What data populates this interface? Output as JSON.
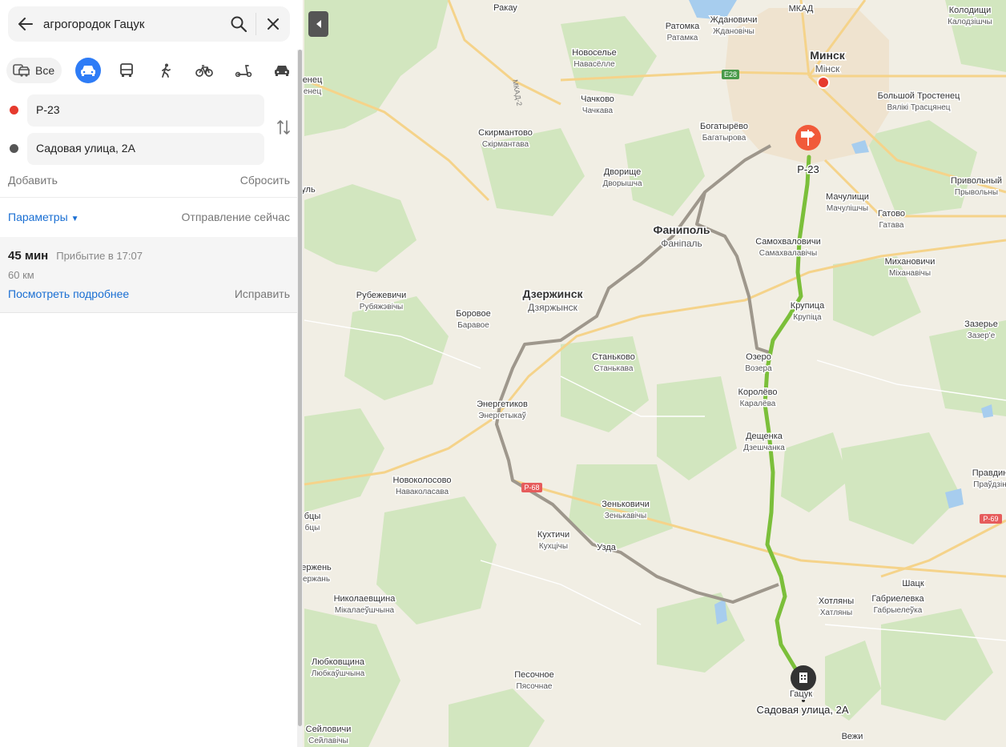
{
  "search": {
    "query": "агрогородок Гацук"
  },
  "modes": {
    "all_label": "Все"
  },
  "route": {
    "from": "Р-23",
    "to": "Садовая улица, 2А",
    "add_label": "Добавить",
    "reset_label": "Сбросить",
    "params_label": "Параметры",
    "depart_label": "Отправление сейчас"
  },
  "result": {
    "duration": "45 мин",
    "arrival": "Прибытие в 17:07",
    "distance": "60 км",
    "details_label": "Посмотреть подробнее",
    "fix_label": "Исправить"
  },
  "colors": {
    "accent": "#2e7cf6",
    "route_green": "#7bbf3a",
    "route_alt": "#a09a90",
    "start_dot": "#e63a2e",
    "end_dot": "#555555",
    "link": "#1a6fd3"
  },
  "map": {
    "places": [
      {
        "ru": "Ракау",
        "by": ""
      },
      {
        "ru": "Ждановичи",
        "by": "Ждановічы"
      },
      {
        "ru": "Ратомка",
        "by": "Ратамка"
      },
      {
        "ru": "МКАД",
        "by": ""
      },
      {
        "ru": "Колодищи",
        "by": "Калодзішчы"
      },
      {
        "ru": "Новоселье",
        "by": "Навасёлле"
      },
      {
        "ru": "Минск",
        "by": "Мінск"
      },
      {
        "ru": "Чачково",
        "by": "Чачкава"
      },
      {
        "ru": "Скирмантово",
        "by": "Скірмантава"
      },
      {
        "ru": "Богатырёво",
        "by": "Багатырова"
      },
      {
        "ru": "Большой Тростенец",
        "by": "Вялікі Трасцянец"
      },
      {
        "ru": "Дворище",
        "by": "Дворышча"
      },
      {
        "ru": "Мачулищи",
        "by": "Мачулішчы"
      },
      {
        "ru": "Привольный",
        "by": "Прывольны"
      },
      {
        "ru": "Фаниполь",
        "by": "Фаніпаль"
      },
      {
        "ru": "Самохваловичи",
        "by": "Самахвалавічы"
      },
      {
        "ru": "Гатово",
        "by": "Гатава"
      },
      {
        "ru": "Михановичи",
        "by": "Міханавічы"
      },
      {
        "ru": "Рубежевичи",
        "by": "Рубяжэвічы"
      },
      {
        "ru": "Дзержинск",
        "by": "Дзяржынск"
      },
      {
        "ru": "Боровое",
        "by": "Баравое"
      },
      {
        "ru": "Крупица",
        "by": "Крупіца"
      },
      {
        "ru": "Зазерье",
        "by": "Зазер'е"
      },
      {
        "ru": "Станьково",
        "by": "Станькава"
      },
      {
        "ru": "Озеро",
        "by": "Возера"
      },
      {
        "ru": "Королёво",
        "by": "Каралёва"
      },
      {
        "ru": "Энергетиков",
        "by": "Энергетыкаў"
      },
      {
        "ru": "Дещенка",
        "by": "Дзешчанка"
      },
      {
        "ru": "Новоколосово",
        "by": "Наваколасава"
      },
      {
        "ru": "Правдин",
        "by": "Праўдзін"
      },
      {
        "ru": "Зеньковичи",
        "by": "Зенькавічы"
      },
      {
        "ru": "Кухтичи",
        "by": "Кухцічы"
      },
      {
        "ru": "Узда",
        "by": ""
      },
      {
        "ru": "Шацк",
        "by": ""
      },
      {
        "ru": "Хотляны",
        "by": "Хатляны"
      },
      {
        "ru": "Габриелевка",
        "by": "Габрыелеўка"
      },
      {
        "ru": "Николаевщина",
        "by": "Мікалаеўшчына"
      },
      {
        "ru": "Любковщина",
        "by": "Любкаўшчына"
      },
      {
        "ru": "Песочное",
        "by": "Пясочнае"
      },
      {
        "ru": "Гацук",
        "by": ""
      },
      {
        "ru": "Сейловичи",
        "by": "Сейлавічы"
      },
      {
        "ru": "Вежи",
        "by": ""
      },
      {
        "ru": "бцы",
        "by": "бцы"
      },
      {
        "ru": "енец",
        "by": "енец"
      },
      {
        "ru": "ержень",
        "by": "ержань"
      },
      {
        "ru": "уль",
        "by": ""
      }
    ],
    "road_labels": [
      "E28",
      "Р-68",
      "Р-69",
      "МКАД-2"
    ],
    "start_label": "Р-23",
    "end_label": "Садовая улица, 2А",
    "end_place": "Гацук"
  }
}
